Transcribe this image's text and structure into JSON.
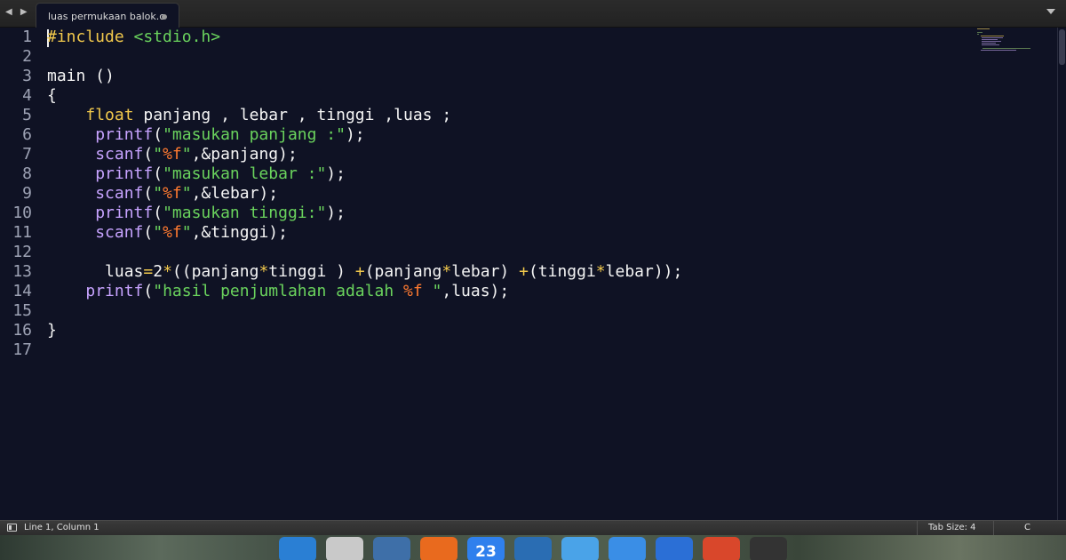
{
  "tab": {
    "title": "luas permukaan balok.c"
  },
  "editor": {
    "line_numbers": [
      "1",
      "2",
      "3",
      "4",
      "5",
      "6",
      "7",
      "8",
      "9",
      "10",
      "11",
      "12",
      "13",
      "14",
      "15",
      "16",
      "17"
    ]
  },
  "status": {
    "position": "Line 1, Column 1",
    "tab_size": "Tab Size: 4",
    "syntax": "C"
  },
  "dock": {
    "items": [
      {
        "name": "thunderbird",
        "color": "#2a7fd4"
      },
      {
        "name": "trash",
        "color": "#c9c9c9"
      },
      {
        "name": "screenshot",
        "color": "#3e6fa8"
      },
      {
        "name": "firefox",
        "color": "#e96a1e"
      },
      {
        "name": "calendar",
        "color": "#2f80ed",
        "label": "23"
      },
      {
        "name": "browser",
        "color": "#2a6db3"
      },
      {
        "name": "files",
        "color": "#4aa3e8"
      },
      {
        "name": "finder",
        "color": "#3a8ee6"
      },
      {
        "name": "word",
        "color": "#2b6fd6"
      },
      {
        "name": "presentation",
        "color": "#d9472b"
      },
      {
        "name": "code-editor",
        "color": "#333333"
      }
    ]
  }
}
